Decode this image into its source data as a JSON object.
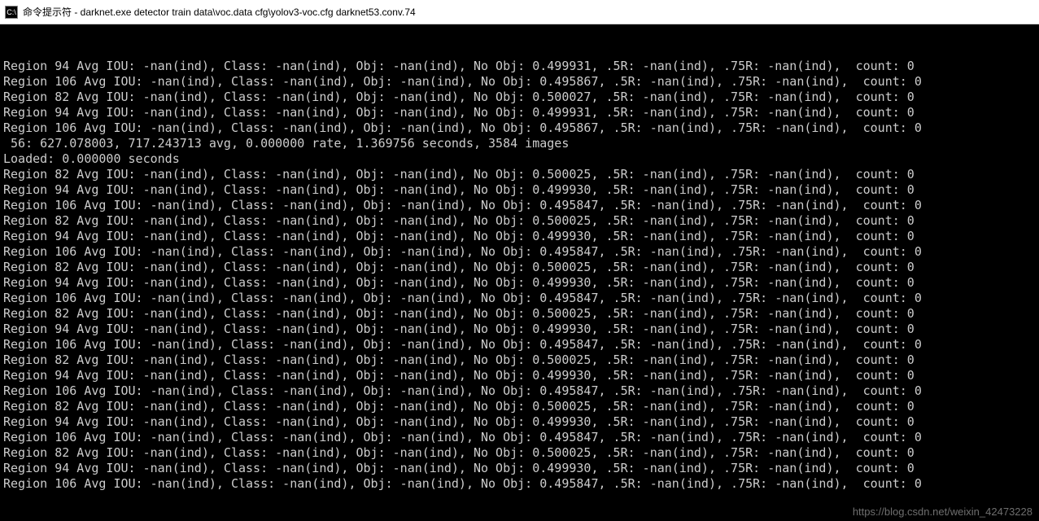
{
  "titlebar": {
    "icon_label": "C:\\",
    "title": "命令提示符 - darknet.exe  detector train data\\voc.data cfg\\yolov3-voc.cfg darknet53.conv.74"
  },
  "nan": "-nan(ind)",
  "top_block": [
    {
      "region": 94,
      "noobj": "0.499931"
    },
    {
      "region": 106,
      "noobj": "0.495867"
    },
    {
      "region": 82,
      "noobj": "0.500027"
    },
    {
      "region": 94,
      "noobj": "0.499931"
    },
    {
      "region": 106,
      "noobj": "0.495867"
    }
  ],
  "summary": {
    "iter": "56",
    "loss": "627.078003",
    "avg": "717.243713",
    "rate": "0.000000",
    "seconds": "1.369756",
    "images": "3584"
  },
  "loaded": "Loaded: 0.000000 seconds",
  "cycle_count": 7,
  "cycle": [
    {
      "region": 82,
      "noobj": "0.500025"
    },
    {
      "region": 94,
      "noobj": "0.499930"
    },
    {
      "region": 106,
      "noobj": "0.495847"
    }
  ],
  "watermark": "https://blog.csdn.net/weixin_42473228"
}
